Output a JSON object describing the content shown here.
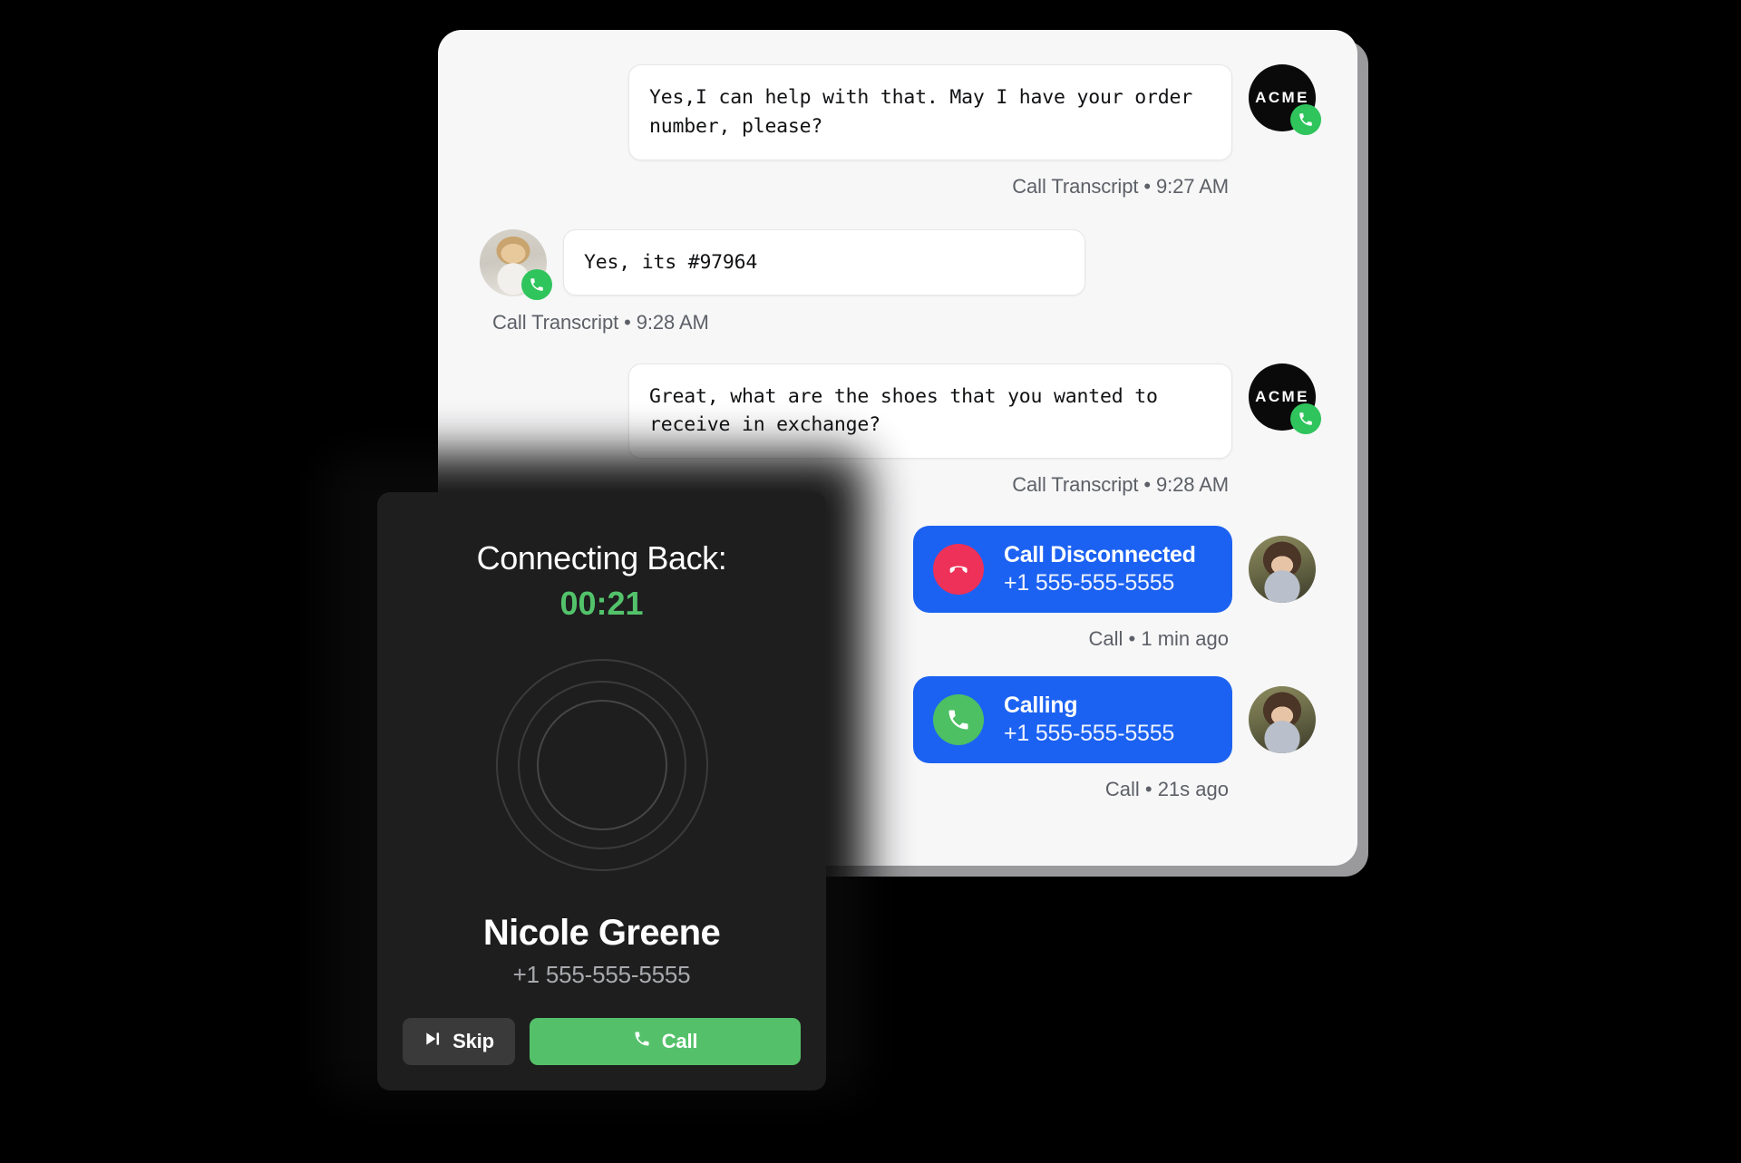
{
  "theme": {
    "page_bg": "#000000",
    "chat_card_bg": "#f7f7f8",
    "bubble_bg": "#ffffff",
    "call_card_blue": "#1c62f2",
    "disconnect_red": "#ee3158",
    "call_green": "#4cc063",
    "dark_card_bg": "#1e1e1e",
    "timer_green": "#53c36b",
    "meta_text": "#5d6067"
  },
  "chat": {
    "messages": [
      {
        "id": "msg-1",
        "side": "right",
        "sender": "agent",
        "avatar": "acme-logo",
        "avatar_label": "ACME",
        "badge": "phone-icon",
        "text": "Yes,I can help with that. May I have your order number, please?",
        "meta": "Call Transcript • 9:27 AM"
      },
      {
        "id": "msg-2",
        "side": "left",
        "sender": "customer",
        "avatar": "customer-photo",
        "badge": "phone-icon",
        "text": "Yes, its #97964",
        "meta": "Call Transcript • 9:28 AM"
      },
      {
        "id": "msg-3",
        "side": "right",
        "sender": "agent",
        "avatar": "acme-logo",
        "avatar_label": "ACME",
        "badge": "phone-icon",
        "text": "Great, what are the shoes that you wanted to receive in exchange?",
        "meta": "Call Transcript • 9:28 AM"
      }
    ],
    "call_events": [
      {
        "id": "event-disconnected",
        "icon": "phone-hangup-icon",
        "icon_color": "#ee3158",
        "title": "Call Disconnected",
        "number": "+1 555-555-5555",
        "meta": "Call • 1 min ago"
      },
      {
        "id": "event-calling",
        "icon": "phone-icon",
        "icon_color": "#4cc063",
        "title": "Calling",
        "number": "+1 555-555-5555",
        "meta": "Call • 21s ago"
      }
    ]
  },
  "call_card": {
    "status_label": "Connecting Back:",
    "timer": "00:21",
    "caller_name": "Nicole Greene",
    "caller_number": "+1 555-555-5555",
    "avatar": "nicole-greene-photo",
    "buttons": {
      "skip": {
        "label": "Skip",
        "icon": "skip-forward-icon"
      },
      "call": {
        "label": "Call",
        "icon": "phone-icon"
      }
    }
  }
}
